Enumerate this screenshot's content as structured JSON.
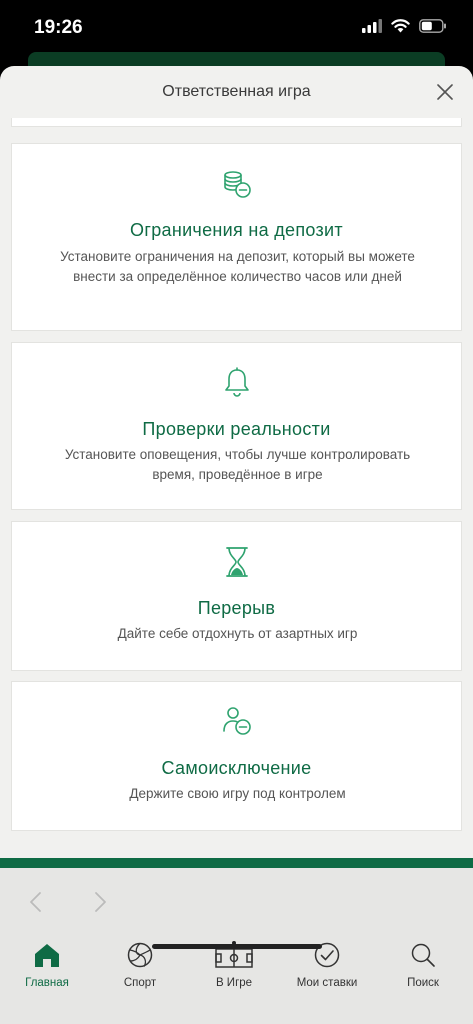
{
  "status_bar": {
    "time": "19:26"
  },
  "sheet": {
    "title": "Ответственная игра"
  },
  "cards": [
    {
      "icon": "coins-icon",
      "title": "Ограничения на депозит",
      "description": "Установите ограничения на депозит, который вы можете внести за определённое количество часов или дней"
    },
    {
      "icon": "bell-icon",
      "title": "Проверки реальности",
      "description": "Установите оповещения, чтобы лучше контролировать время, проведённое в игре"
    },
    {
      "icon": "hourglass-icon",
      "title": "Перерыв",
      "description": "Дайте себе отдохнуть от азартных игр"
    },
    {
      "icon": "user-minus-icon",
      "title": "Самоисключение",
      "description": "Держите свою игру под контролем"
    }
  ],
  "bottom_nav": {
    "tabs": [
      {
        "label": "Главная",
        "icon": "home-icon",
        "active": true
      },
      {
        "label": "Спорт",
        "icon": "ball-icon",
        "active": false
      },
      {
        "label": "В Игре",
        "icon": "field-icon",
        "active": false
      },
      {
        "label": "Мои ставки",
        "icon": "check-circle-icon",
        "active": false
      },
      {
        "label": "Поиск",
        "icon": "search-icon",
        "active": false
      }
    ]
  },
  "colors": {
    "accent": "#0f6b45",
    "icon_green": "#2fa36f",
    "sheet_bg": "#f1f1ef"
  }
}
